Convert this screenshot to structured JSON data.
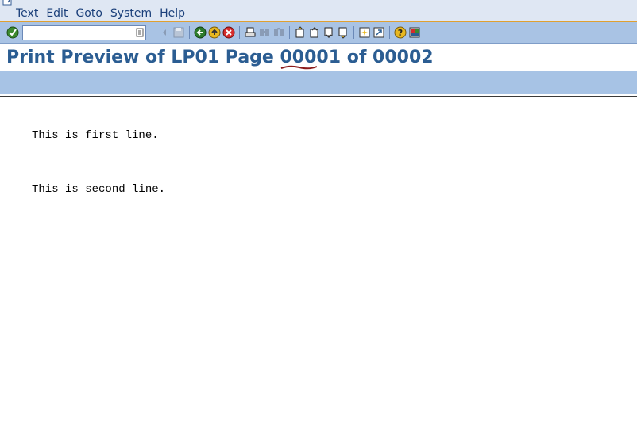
{
  "menu": {
    "items": [
      "Text",
      "Edit",
      "Goto",
      "System",
      "Help"
    ]
  },
  "toolbar": {
    "command_value": "",
    "icons": [
      "enter-icon",
      "save-icon",
      "back-icon",
      "exit-icon",
      "cancel-icon",
      "print-icon",
      "find-icon",
      "find-next-icon",
      "first-page-icon",
      "previous-page-icon",
      "next-page-icon",
      "last-page-icon",
      "create-session-icon",
      "shortcut-icon",
      "help-icon",
      "layout-icon"
    ]
  },
  "title": {
    "text": "Print Preview of LP01 Page 00001 of 00002"
  },
  "content": {
    "lines": [
      "This is first line.",
      "This is second line."
    ]
  }
}
